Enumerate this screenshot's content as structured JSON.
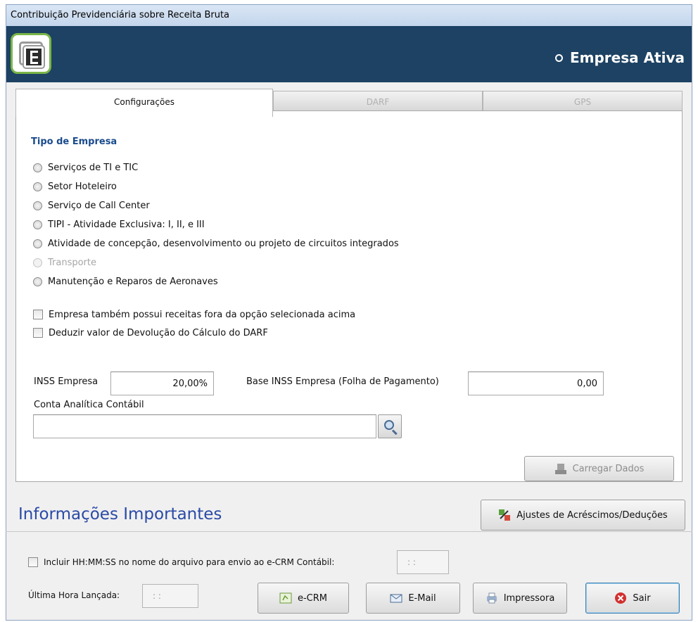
{
  "window": {
    "title": "Contribuição Previdenciária sobre Receita Bruta"
  },
  "banner": {
    "company_label": "Empresa Ativa"
  },
  "tabs": [
    {
      "label": "Configurações",
      "active": true
    },
    {
      "label": "DARF",
      "active": false
    },
    {
      "label": "GPS",
      "active": false
    }
  ],
  "config": {
    "section_title": "Tipo de Empresa",
    "radio_options": [
      {
        "label": "Serviços de TI e TIC",
        "enabled": true
      },
      {
        "label": "Setor Hoteleiro",
        "enabled": true
      },
      {
        "label": "Serviço de Call Center",
        "enabled": true
      },
      {
        "label": "TIPI - Atividade Exclusiva: I, II, e III",
        "enabled": true
      },
      {
        "label": "Atividade de concepção, desenvolvimento ou projeto de circuitos integrados",
        "enabled": true
      },
      {
        "label": "Transporte",
        "enabled": false
      },
      {
        "label": "Manutenção e Reparos de Aeronaves",
        "enabled": true
      }
    ],
    "checkboxes": [
      {
        "label": "Empresa também possui receitas fora da opção selecionada acima",
        "checked": false
      },
      {
        "label": "Deduzir valor de Devolução do Cálculo do DARF",
        "checked": false
      }
    ],
    "inss_label": "INSS Empresa",
    "inss_value": "20,00%",
    "base_inss_label": "Base INSS Empresa (Folha de Pagamento)",
    "base_inss_value": "0,00",
    "conta_label": "Conta Analítica Contábil",
    "conta_value": "",
    "load_button": "Carregar Dados"
  },
  "info": {
    "title": "Informações Importantes",
    "adjust_button": "Ajustes de Acréscimos/Deduções"
  },
  "footer": {
    "include_time_label": "Incluir HH:MM:SS no nome do arquivo para envio ao e-CRM Contábil:",
    "include_time_value": ": :",
    "last_time_label": "Última Hora Lançada:",
    "last_time_value": ": :",
    "buttons": {
      "ecrm": "e-CRM",
      "email": "E-Mail",
      "printer": "Impressora",
      "exit": "Sair"
    }
  },
  "colors": {
    "banner": "#1d4263",
    "section_title": "#1a4b8c",
    "info_title": "#2a4aa6",
    "exit_icon": "#d32f2f"
  }
}
